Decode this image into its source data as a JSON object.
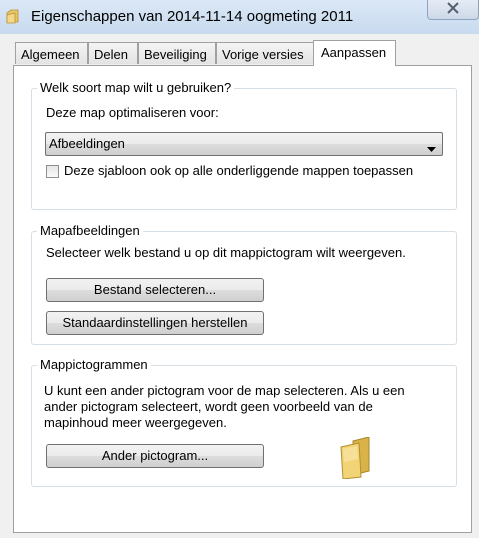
{
  "window": {
    "title": "Eigenschappen van 2014-11-14 oogmeting 2011"
  },
  "tabs": [
    {
      "label": "Algemeen"
    },
    {
      "label": "Delen"
    },
    {
      "label": "Beveiliging"
    },
    {
      "label": "Vorige versies"
    },
    {
      "label": "Aanpassen",
      "active": true
    }
  ],
  "folder_type": {
    "group_title": "Welk soort map wilt u gebruiken?",
    "optimize_label": "Deze map optimaliseren voor:",
    "selected_value": "Afbeeldingen",
    "apply_template_label": "Deze sjabloon ook op alle onderliggende mappen toepassen",
    "apply_template_checked": false
  },
  "folder_pictures": {
    "group_title": "Mapafbeeldingen",
    "description": "Selecteer welk bestand u op dit mappictogram wilt weergeven.",
    "select_file_button": "Bestand selecteren...",
    "restore_default_button": "Standaardinstellingen herstellen"
  },
  "folder_icons": {
    "group_title": "Mappictogrammen",
    "description_lines": [
      "U kunt een ander pictogram voor de map selecteren. Als u een",
      "ander pictogram selecteert, wordt geen voorbeeld van de",
      "mapinhoud meer weergegeven."
    ],
    "change_icon_button": "Ander pictogram..."
  },
  "icons": {
    "title_icon": "folder-icon",
    "close": "close-icon",
    "preview": "folder-icon"
  }
}
